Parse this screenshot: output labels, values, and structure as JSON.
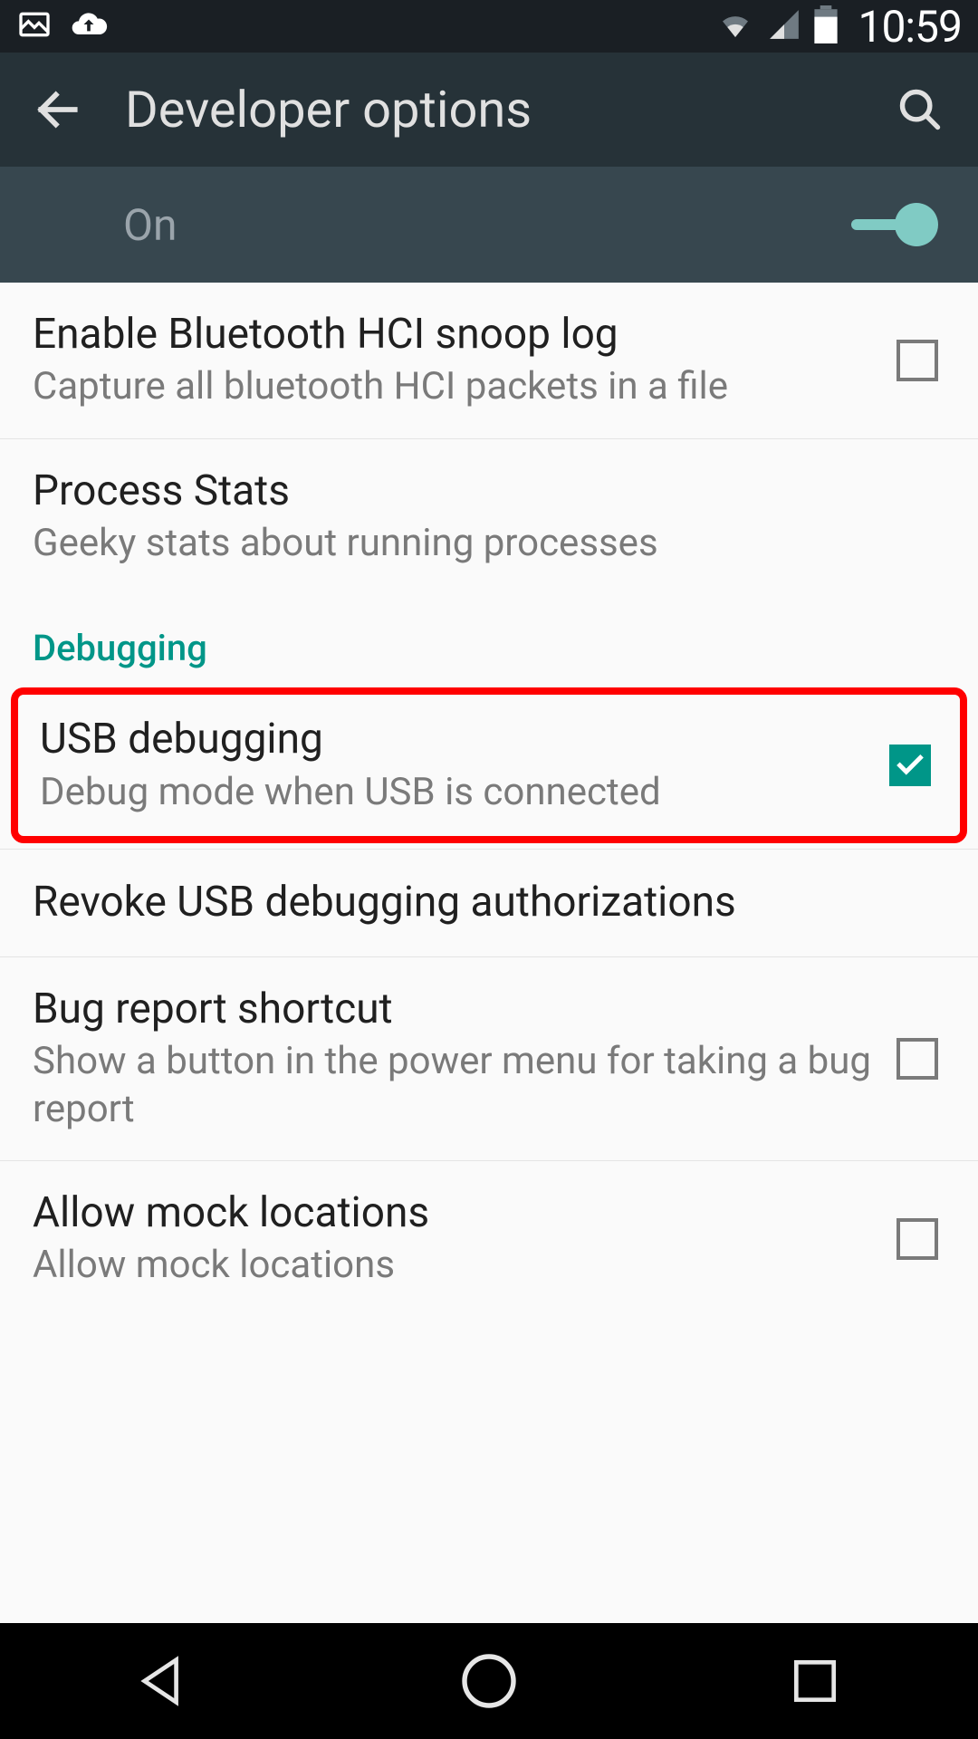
{
  "status": {
    "time": "10:59"
  },
  "header": {
    "title": "Developer options"
  },
  "master": {
    "label": "On",
    "enabled": true
  },
  "items": [
    {
      "title": "Enable Bluetooth HCI snoop log",
      "sub": "Capture all bluetooth HCI packets in a file",
      "kind": "check",
      "checked": false
    },
    {
      "title": "Process Stats",
      "sub": "Geeky stats about running processes",
      "kind": "link"
    }
  ],
  "section": "Debugging",
  "debug_items": [
    {
      "title": "USB debugging",
      "sub": "Debug mode when USB is connected",
      "kind": "check",
      "checked": true,
      "highlight": true
    },
    {
      "title": "Revoke USB debugging authorizations",
      "sub": "",
      "kind": "link"
    },
    {
      "title": "Bug report shortcut",
      "sub": "Show a button in the power menu for taking a bug report",
      "kind": "check",
      "checked": false
    },
    {
      "title": "Allow mock locations",
      "sub": "Allow mock locations",
      "kind": "check",
      "checked": false
    }
  ],
  "colors": {
    "accent": "#009688",
    "highlight": "#ff0000"
  }
}
